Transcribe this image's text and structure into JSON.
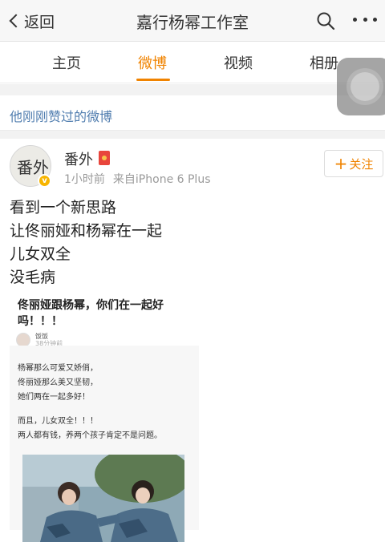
{
  "navbar": {
    "back_label": "返回",
    "title": "嘉行杨幂工作室",
    "search_icon": "search-icon",
    "more_icon": "more-icon"
  },
  "tabs": [
    {
      "label": "主页",
      "active": false
    },
    {
      "label": "微博",
      "active": true
    },
    {
      "label": "视频",
      "active": false
    },
    {
      "label": "相册",
      "active": false
    }
  ],
  "liked": {
    "label": "他刚刚赞过的微博"
  },
  "post": {
    "author": "番外",
    "avatar_text": "番外",
    "time": "1小时前",
    "source": "来自iPhone 6 Plus",
    "follow_label": "关注",
    "lines": [
      "看到一个新思路",
      "让佟丽娅和杨幂在一起",
      "儿女双全",
      "没毛病"
    ],
    "embed": {
      "title": "佟丽娅跟杨幂，你们在一起好吗！！！",
      "author": "饭饭",
      "time": "38分钟前",
      "body_lines": [
        "杨幂那么可爱又娇俏，",
        "佟丽娅那么美又坚韧，",
        "她们两在一起多好！",
        "",
        "而且，儿女双全！！！",
        "两人都有钱，养两个孩子肯定不是问题。"
      ]
    }
  },
  "colors": {
    "accent": "#f08300",
    "link": "#507daf",
    "verified": "#f7b500"
  }
}
